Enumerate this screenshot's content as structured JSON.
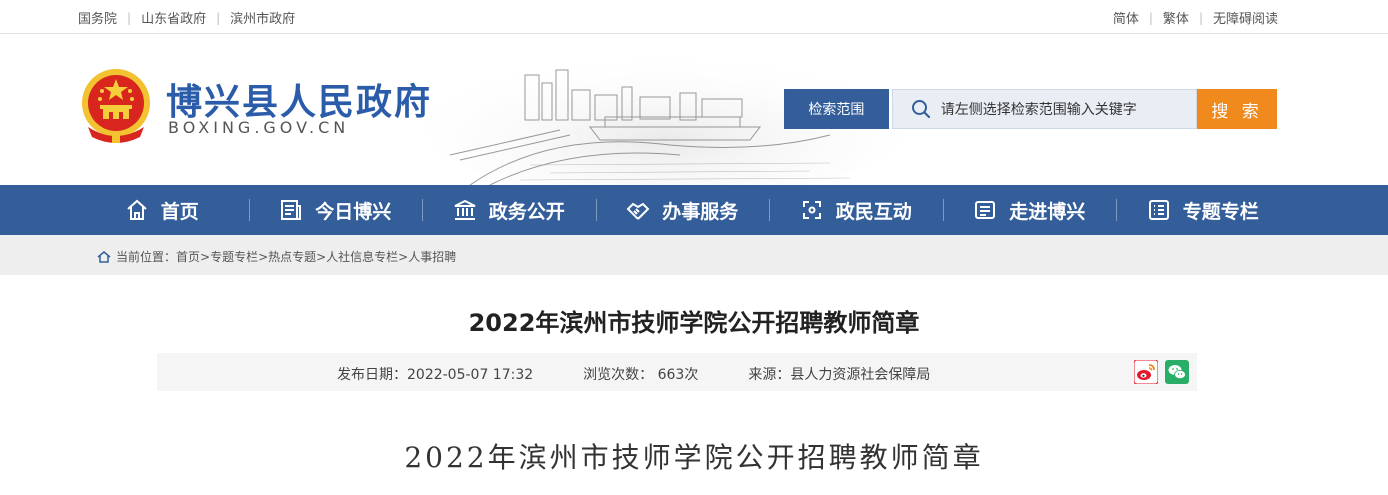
{
  "topbar": {
    "links": [
      "国务院",
      "山东省政府",
      "滨州市政府"
    ],
    "right_links": [
      "简体",
      "繁体",
      "无障碍阅读"
    ]
  },
  "header": {
    "title": "博兴县人民政府",
    "subtitle": "BOXING.GOV.CN",
    "search": {
      "scope_label": "检索范围",
      "placeholder": "请左侧选择检索范围输入关键字",
      "button_label": "搜 索"
    }
  },
  "nav": {
    "items": [
      {
        "label": "首页",
        "icon": "home-icon"
      },
      {
        "label": "今日博兴",
        "icon": "news-icon"
      },
      {
        "label": "政务公开",
        "icon": "government-building-icon"
      },
      {
        "label": "办事服务",
        "icon": "handshake-icon"
      },
      {
        "label": "政民互动",
        "icon": "interaction-icon"
      },
      {
        "label": "走进博兴",
        "icon": "profile-card-icon"
      },
      {
        "label": "专题专栏",
        "icon": "list-icon"
      }
    ]
  },
  "breadcrumb": {
    "prefix": "当前位置：",
    "path": "首页>专题专栏>热点专题>人社信息专栏>人事招聘"
  },
  "article": {
    "title": "2022年滨州市技师学院公开招聘教师简章",
    "publish_date": "发布日期：2022-05-07 17:32",
    "views": "浏览次数： 663次",
    "source": "来源：县人力资源社会保障局",
    "body_title": "2022年滨州市技师学院公开招聘教师简章"
  },
  "colors": {
    "brand_blue": "#335e9a",
    "title_blue": "#2a5caa",
    "search_orange": "#f08a1c",
    "weibo_red": "#e6162d",
    "wechat_green": "#2aae67"
  }
}
